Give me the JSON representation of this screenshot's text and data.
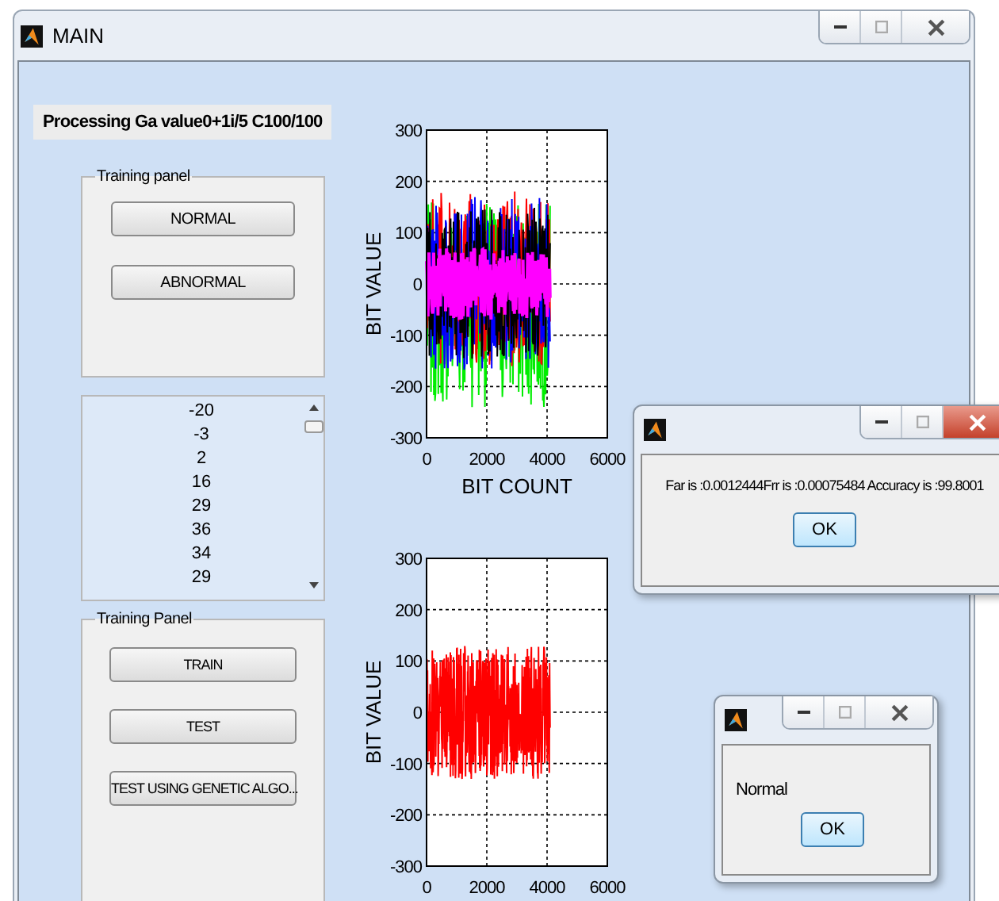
{
  "main_window": {
    "title": "MAIN",
    "status_label": "Processing Ga value0+1i/5  C100/100",
    "training_panel": {
      "title": "Training panel",
      "buttons": [
        "NORMAL",
        "ABNORMAL"
      ]
    },
    "value_list": {
      "items": [
        "-20",
        "-3",
        "2",
        "16",
        "29",
        "36",
        "34",
        "29"
      ]
    },
    "test_panel": {
      "title": "Training Panel",
      "buttons": [
        "TRAIN",
        "TEST",
        "TEST USING GENETIC ALGO..."
      ]
    },
    "plots": [
      {
        "kind": "multichannel",
        "ylabel": "BIT VALUE",
        "xlabel": "BIT COUNT",
        "yticks": [
          "300",
          "200",
          "100",
          "0",
          "-100",
          "-200",
          "-300"
        ],
        "xticks": [
          "0",
          "2000",
          "4000",
          "6000"
        ]
      },
      {
        "kind": "single",
        "ylabel": "BIT VALUE",
        "yticks": [
          "300",
          "200",
          "100",
          "0",
          "-100",
          "-200",
          "-300"
        ],
        "xticks": [
          "0",
          "2000",
          "4000",
          "6000"
        ]
      }
    ]
  },
  "dialogs": [
    {
      "message": "Far is :0.0012444Frr is :0.00075484 Accuracy is :99.8001",
      "button": "OK",
      "close_active": true
    },
    {
      "message": "Normal",
      "button": "OK",
      "close_active": false
    }
  ]
}
